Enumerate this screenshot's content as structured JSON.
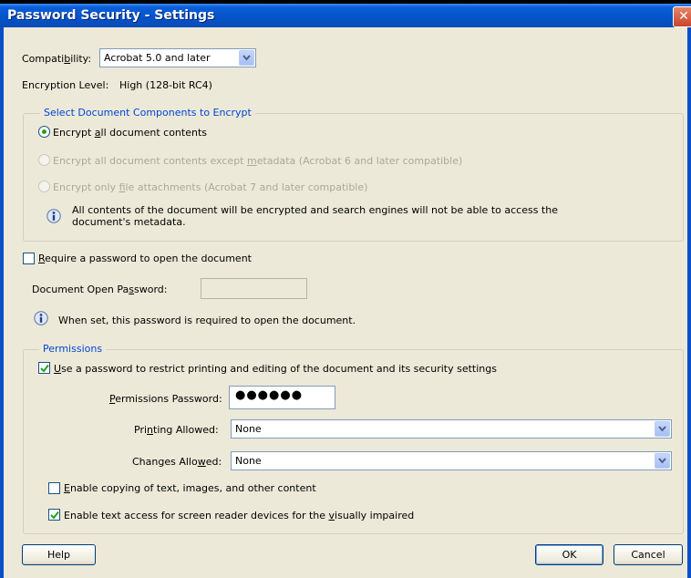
{
  "window": {
    "title": "Password Security - Settings",
    "close_glyph": "✕"
  },
  "compatibility": {
    "label_pre": "Compati",
    "label_u": "b",
    "label_post": "ility:",
    "value": "Acrobat 5.0 and later"
  },
  "encryption": {
    "label": "Encryption Level:",
    "value": "High (128-bit RC4)"
  },
  "encrypt_group": {
    "legend": "Select Document Components to Encrypt",
    "options": [
      {
        "pre": "Encrypt ",
        "u": "a",
        "post": "ll document contents",
        "selected": true,
        "enabled": true
      },
      {
        "pre": "Encrypt all document contents except ",
        "u": "m",
        "post": "etadata (Acrobat 6 and later compatible)",
        "selected": false,
        "enabled": false
      },
      {
        "pre": "Encrypt only ",
        "u": "f",
        "post": "ile attachments (Acrobat 7 and later compatible)",
        "selected": false,
        "enabled": false
      }
    ],
    "info_line1": "All contents of the document will be encrypted and search engines will not be able to access the",
    "info_line2": "document's metadata."
  },
  "open_password": {
    "checkbox_u": "R",
    "checkbox_post": "equire a password to open the document",
    "checked": false,
    "field_label_pre": "Document Open Pa",
    "field_label_u": "s",
    "field_label_post": "sword:",
    "info": "When set, this password is required to open the document."
  },
  "permissions": {
    "legend": "Permissions",
    "restrict_u": "U",
    "restrict_post": "se a password to restrict printing and editing of the document and its security settings",
    "restrict_checked": true,
    "pwd_label_u": "P",
    "pwd_label_post": "ermissions Password:",
    "pwd_mask": "●●●●●●",
    "printing_label_pre": "Pri",
    "printing_label_u": "n",
    "printing_label_post": "ting Allowed:",
    "printing_value": "None",
    "changes_label_pre": "Changes Allo",
    "changes_label_u": "w",
    "changes_label_post": "ed:",
    "changes_value": "None",
    "copy_u": "E",
    "copy_post": "nable copying of text, images, and other content",
    "copy_checked": false,
    "reader_pre": "Enable text access for screen reader devices for the ",
    "reader_u": "v",
    "reader_post": "isually impaired",
    "reader_checked": true
  },
  "buttons": {
    "help": "Help",
    "ok": "OK",
    "cancel": "Cancel"
  },
  "colors": {
    "title_bar": "#0453c9",
    "face": "#ece9d8",
    "legend": "#0046d5",
    "check": "#21a121"
  },
  "icons": [
    "close-icon",
    "dropdown-arrow-icon",
    "radio-icon",
    "info-icon",
    "checkmark-icon"
  ]
}
